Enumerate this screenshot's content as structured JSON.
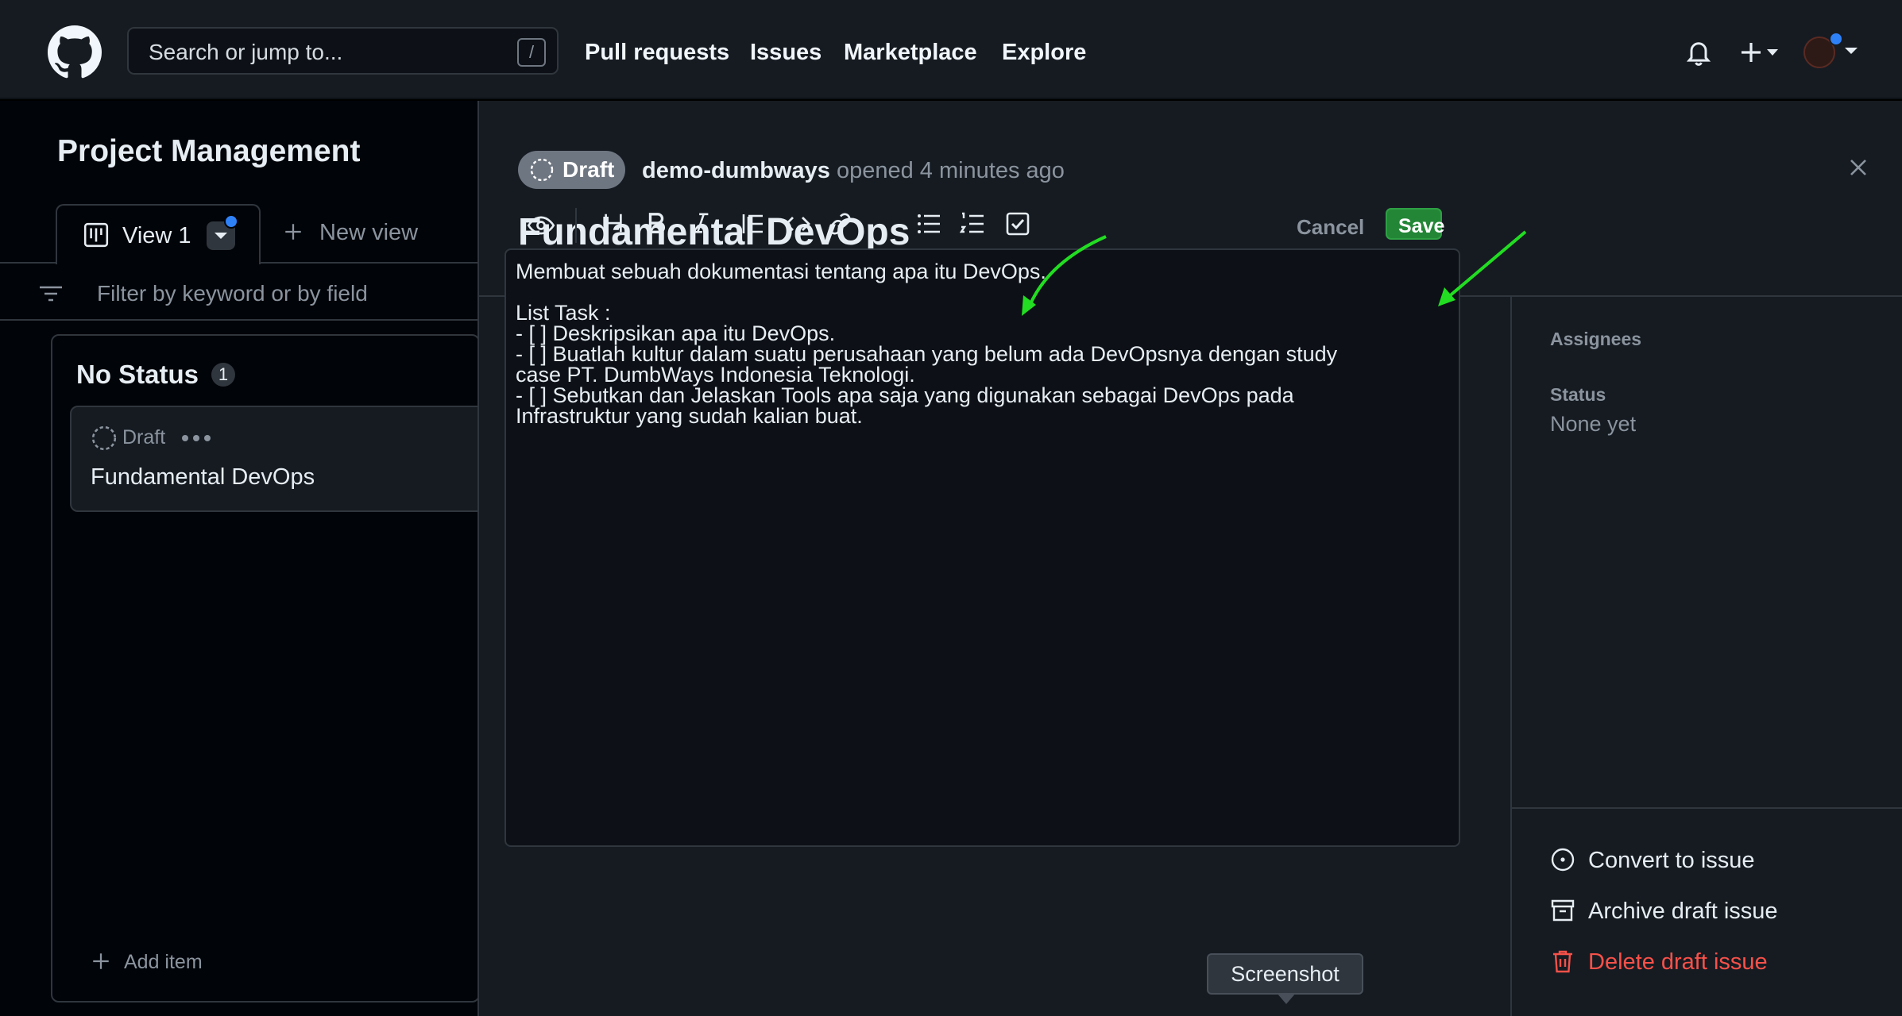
{
  "header": {
    "search_placeholder": "Search or jump to...",
    "search_shortcut": "/",
    "nav": [
      "Pull requests",
      "Issues",
      "Marketplace",
      "Explore"
    ]
  },
  "board": {
    "project_title": "Project Management",
    "active_view_label": "View 1",
    "new_view_label": "New view",
    "filter_placeholder": "Filter by keyword or by field",
    "column": {
      "title": "No Status",
      "count": "1",
      "card": {
        "status": "Draft",
        "title": "Fundamental DevOps"
      },
      "add_item_label": "Add item"
    }
  },
  "detail": {
    "state_badge": "Draft",
    "author": "demo-dumbways",
    "opened_text": "opened 4 minutes ago",
    "title": "Fundamental DevOps",
    "toolbar": {
      "cancel_label": "Cancel",
      "save_label": "Save"
    },
    "body_lines": [
      "Membuat sebuah dokumentasi tentang apa itu DevOps.",
      "",
      "List Task :",
      "- [ ] Deskripsikan apa itu DevOps.",
      "- [ ] Buatlah kultur dalam suatu perusahaan yang belum ada DevOpsnya dengan study",
      "case PT. DumbWays Indonesia Teknologi.",
      "- [ ] Sebutkan dan Jelaskan Tools apa saja yang digunakan sebagai DevOps pada",
      "Infrastruktur yang sudah kalian buat."
    ],
    "sidebar": {
      "assignees_label": "Assignees",
      "status_label": "Status",
      "status_value": "None yet",
      "actions": {
        "convert": "Convert to issue",
        "archive": "Archive draft issue",
        "delete": "Delete draft issue"
      }
    }
  },
  "tooltip": "Screenshot",
  "colors": {
    "save_green": "#238636",
    "danger_red": "#f85149",
    "annotation_arrow": "#22dd22",
    "notification_dot": "#2f81f7"
  }
}
